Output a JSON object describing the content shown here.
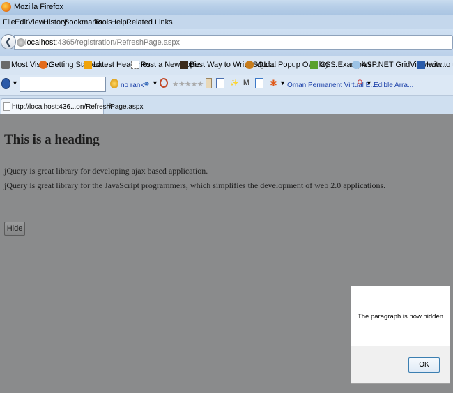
{
  "window": {
    "title": "Mozilla Firefox"
  },
  "menu": [
    "File",
    "Edit",
    "View",
    "History",
    "Bookmarks",
    "Tools",
    "Help",
    "Related Links"
  ],
  "url": {
    "host": "localhost",
    "rest": ":4365/registration/RefreshPage.aspx"
  },
  "bookmarks": [
    {
      "label": "Most Visited",
      "icon": "most-visited-icon",
      "color": "#6a6a6a"
    },
    {
      "label": "Getting Started",
      "icon": "firefox-icon",
      "color": "#e36b1c"
    },
    {
      "label": "Latest Headlines",
      "icon": "rss-icon",
      "color": "#f0a30a"
    },
    {
      "label": "Post a New Topic",
      "icon": "page-icon",
      "color": "#ffffff"
    },
    {
      "label": "Best Way to Write SQL ...",
      "icon": "sql-icon",
      "color": "#3b2a1a"
    },
    {
      "label": "Modal Popup Overlay ...",
      "icon": "popup-icon",
      "color": "#c77d1d"
    },
    {
      "label": "CSS Examples",
      "icon": "css-icon",
      "color": "#5aa02c"
    },
    {
      "label": "ASP.NET GridView wit...",
      "icon": "aspnet-icon",
      "color": "#9cc3e6"
    },
    {
      "label": "How to use I",
      "icon": "doc-icon",
      "color": "#2a5caa"
    }
  ],
  "toolbar": {
    "rank_label": "no rank",
    "oman_label": "Oman Permanent Virtual E...",
    "edible_label": "Edible Arra...",
    "search_value": ""
  },
  "tab": {
    "title": "http://localhost:436...on/RefreshPage.aspx",
    "new_tab_label": "+"
  },
  "page": {
    "heading": "This is a heading",
    "paragraph1": "jQuery is great library for developing ajax based application.",
    "paragraph2": "jQuery is great library for the JavaScript programmers, which simplifies the development of web 2.0 applications.",
    "hide_button": "Hide"
  },
  "dialog": {
    "message": "The paragraph is now hidden",
    "ok_label": "OK"
  },
  "colors": {
    "overlay": "#8a8b8c",
    "link_blue": "#1a3fa8",
    "dialog_border": "#3c7fb1"
  }
}
